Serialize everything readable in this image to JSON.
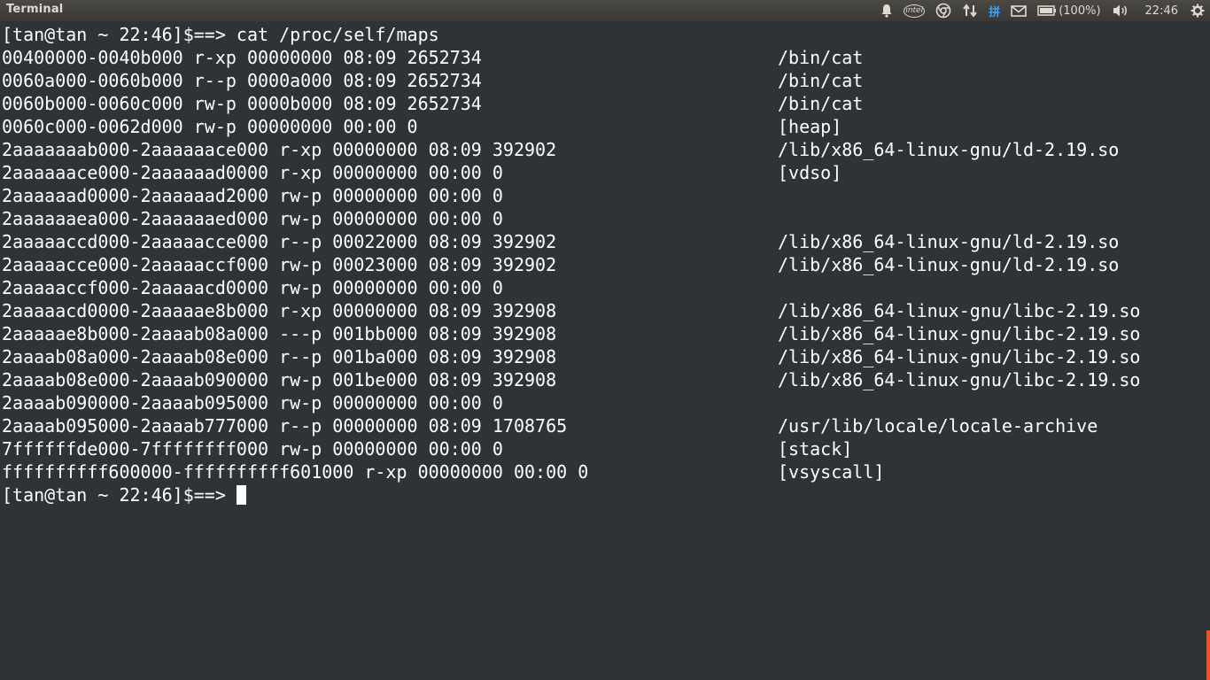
{
  "topbar": {
    "title": "Terminal",
    "intel_label": "intel",
    "ime_label": "拼",
    "battery_text": "(100%)",
    "clock": "22:46"
  },
  "terminal": {
    "command_line": "[tan@tan ~ 22:46]$==> cat /proc/self/maps",
    "rows": [
      {
        "left": "00400000-0040b000 r-xp 00000000 08:09 2652734",
        "right": "/bin/cat"
      },
      {
        "left": "0060a000-0060b000 r--p 0000a000 08:09 2652734",
        "right": "/bin/cat"
      },
      {
        "left": "0060b000-0060c000 rw-p 0000b000 08:09 2652734",
        "right": "/bin/cat"
      },
      {
        "left": "0060c000-0062d000 rw-p 00000000 00:00 0",
        "right": "[heap]"
      },
      {
        "left": "2aaaaaaab000-2aaaaaace000 r-xp 00000000 08:09 392902",
        "right": "/lib/x86_64-linux-gnu/ld-2.19.so"
      },
      {
        "left": "2aaaaaace000-2aaaaaad0000 r-xp 00000000 00:00 0",
        "right": "[vdso]"
      },
      {
        "left": "2aaaaaad0000-2aaaaaad2000 rw-p 00000000 00:00 0",
        "right": ""
      },
      {
        "left": "2aaaaaaea000-2aaaaaaed000 rw-p 00000000 00:00 0",
        "right": ""
      },
      {
        "left": "2aaaaaccd000-2aaaaacce000 r--p 00022000 08:09 392902",
        "right": "/lib/x86_64-linux-gnu/ld-2.19.so"
      },
      {
        "left": "2aaaaacce000-2aaaaaccf000 rw-p 00023000 08:09 392902",
        "right": "/lib/x86_64-linux-gnu/ld-2.19.so"
      },
      {
        "left": "2aaaaaccf000-2aaaaacd0000 rw-p 00000000 00:00 0",
        "right": ""
      },
      {
        "left": "2aaaaacd0000-2aaaaae8b000 r-xp 00000000 08:09 392908",
        "right": "/lib/x86_64-linux-gnu/libc-2.19.so"
      },
      {
        "left": "2aaaaae8b000-2aaaab08a000 ---p 001bb000 08:09 392908",
        "right": "/lib/x86_64-linux-gnu/libc-2.19.so"
      },
      {
        "left": "2aaaab08a000-2aaaab08e000 r--p 001ba000 08:09 392908",
        "right": "/lib/x86_64-linux-gnu/libc-2.19.so"
      },
      {
        "left": "2aaaab08e000-2aaaab090000 rw-p 001be000 08:09 392908",
        "right": "/lib/x86_64-linux-gnu/libc-2.19.so"
      },
      {
        "left": "2aaaab090000-2aaaab095000 rw-p 00000000 00:00 0",
        "right": ""
      },
      {
        "left": "2aaaab095000-2aaaab777000 r--p 00000000 08:09 1708765",
        "right": "/usr/lib/locale/locale-archive"
      },
      {
        "left": "7ffffffde000-7ffffffff000 rw-p 00000000 00:00 0",
        "right": "[stack]"
      },
      {
        "left": "ffffffffff600000-ffffffffff601000 r-xp 00000000 00:00 0",
        "right": "[vsyscall]"
      }
    ],
    "prompt": "[tan@tan ~ 22:46]$==> "
  },
  "colors": {
    "background": "#2f3335",
    "text": "#ffffff",
    "panel": "#3c3b37",
    "accent": "#e95420"
  },
  "icons": [
    "bell-icon",
    "intel-icon",
    "chrome-icon",
    "network-updown-icon",
    "input-method-icon",
    "mail-icon",
    "battery-icon",
    "volume-icon",
    "gear-icon"
  ]
}
